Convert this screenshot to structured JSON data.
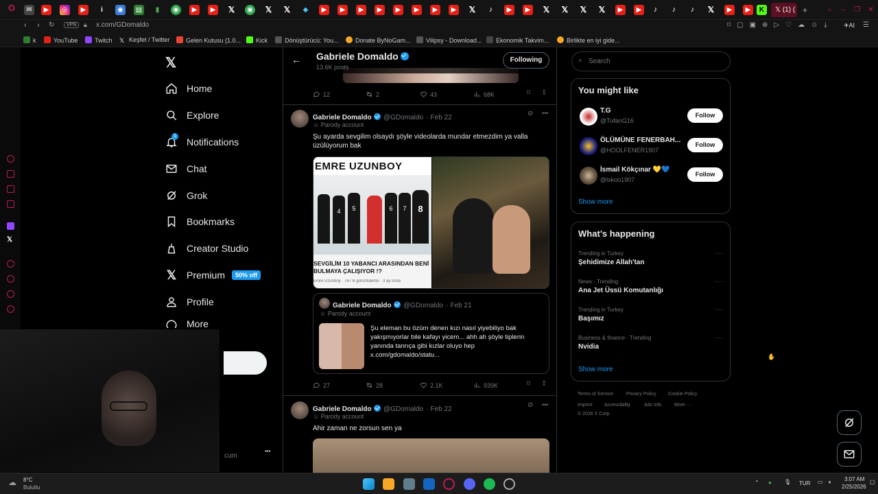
{
  "browser": {
    "active_tab_label": "(1) (",
    "url": "x.com/GDomaldo",
    "vpn_label": "VPN",
    "bookmarks": [
      "k",
      "YouTube",
      "Twitch",
      "Keşfet / Twitter",
      "Gelen Kutusu (1.0...",
      "Kick",
      "Dönüştürücü: You...",
      "Donate ByNoGam...",
      "Vilipsy - Download...",
      "Ekonomik Takvim...",
      "Birlikte en iyi gide..."
    ],
    "ai_label": "AI"
  },
  "nav": {
    "items": [
      {
        "label": "Home",
        "icon": "home-icon"
      },
      {
        "label": "Explore",
        "icon": "search-icon"
      },
      {
        "label": "Notifications",
        "icon": "bell-icon",
        "badge": "1"
      },
      {
        "label": "Chat",
        "icon": "mail-icon"
      },
      {
        "label": "Grok",
        "icon": "grok-icon"
      },
      {
        "label": "Bookmarks",
        "icon": "bookmark-icon"
      },
      {
        "label": "Creator Studio",
        "icon": "creator-icon"
      },
      {
        "label": "Premium",
        "icon": "x-logo-icon"
      },
      {
        "label": "Profile",
        "icon": "person-icon"
      },
      {
        "label": "More",
        "icon": "more-icon"
      }
    ],
    "premium_badge": "50% off",
    "account_partial": "cum",
    "account_dots": "•••"
  },
  "profile_header": {
    "name": "Gabriele Domaldo",
    "posts": "13.6K posts",
    "following_label": "Following"
  },
  "top_metrics": {
    "replies": "12",
    "reposts": "2",
    "likes": "43",
    "views": "68K"
  },
  "tweet1": {
    "name": "Gabriele Domaldo",
    "handle": "@GDomaldo",
    "date": "· Feb 22",
    "label": "Parody account",
    "text": "Şu ayarda sevgilim olsaydı şöyle videolarda mundar etmezdim ya valla üzülüyorum bak",
    "media_left_header": "EMRE UZUNBOY",
    "media_left_caption": "SEVGİLİM 10 YABANCI ARASINDAN BENİ BULMAYA ÇALIŞIYOR !?",
    "media_left_meta": "Emre Uzunboy · 767 B görüntüleme · 3 ay önce",
    "media_left_jersey": [
      "4",
      "5",
      "6",
      "7",
      "8"
    ],
    "quote": {
      "name": "Gabriele Domaldo",
      "handle": "@GDomaldo",
      "date": "· Feb 21",
      "label": "Parody account",
      "text": "Şu eleman bu özüm denen kızı nasıl yiyebiliyo bak yakışmıyorlar bile kafayı yicem... ahh ah şöyle tiplerin yanında tanrıça gibi kızlar oluyo hep x.com/gdomaldo/statu..."
    },
    "metrics": {
      "replies": "27",
      "reposts": "28",
      "likes": "2.1K",
      "views": "939K"
    }
  },
  "tweet2": {
    "name": "Gabriele Domaldo",
    "handle": "@GDomaldo",
    "date": "· Feb 22",
    "label": "Parody account",
    "text": "Ahir zaman ne zorsun sen ya"
  },
  "right": {
    "search_placeholder": "Search",
    "might_like_title": "You might like",
    "suggestions": [
      {
        "name": "T.G",
        "handle": "@TufanG16"
      },
      {
        "name": "ÖLÜMÜNE FENERBAH...",
        "handle": "@HOOLFENER1907"
      },
      {
        "name": "İsmail Kökçınar 💛💙",
        "handle": "@lskoo1907"
      }
    ],
    "follow_label": "Follow",
    "show_more": "Show more",
    "happening_title": "What’s happening",
    "trends": [
      {
        "context": "Trending in Turkey",
        "title": "Şehidimize Allah'tan"
      },
      {
        "context": "News · Trending",
        "title": "Ana Jet Üssü Komutanlığı"
      },
      {
        "context": "Trending in Turkey",
        "title": "Başımız"
      },
      {
        "context": "Business & finance · Trending",
        "title": "Nvidia"
      }
    ],
    "footer_links": [
      "Terms of Service",
      "Privacy Policy",
      "Cookie Policy",
      "Imprint",
      "Accessibility",
      "Ads info",
      "More ···"
    ],
    "copyright": "© 2026 X Corp."
  },
  "taskbar": {
    "weather_temp": "8°C",
    "weather_desc": "Bulutlu",
    "lang": "TUR",
    "time": "3:07 AM",
    "date": "2/25/2026"
  },
  "colors": {
    "accent": "#1d9bf0",
    "browser_accent": "#c2185b",
    "background": "#000000"
  }
}
